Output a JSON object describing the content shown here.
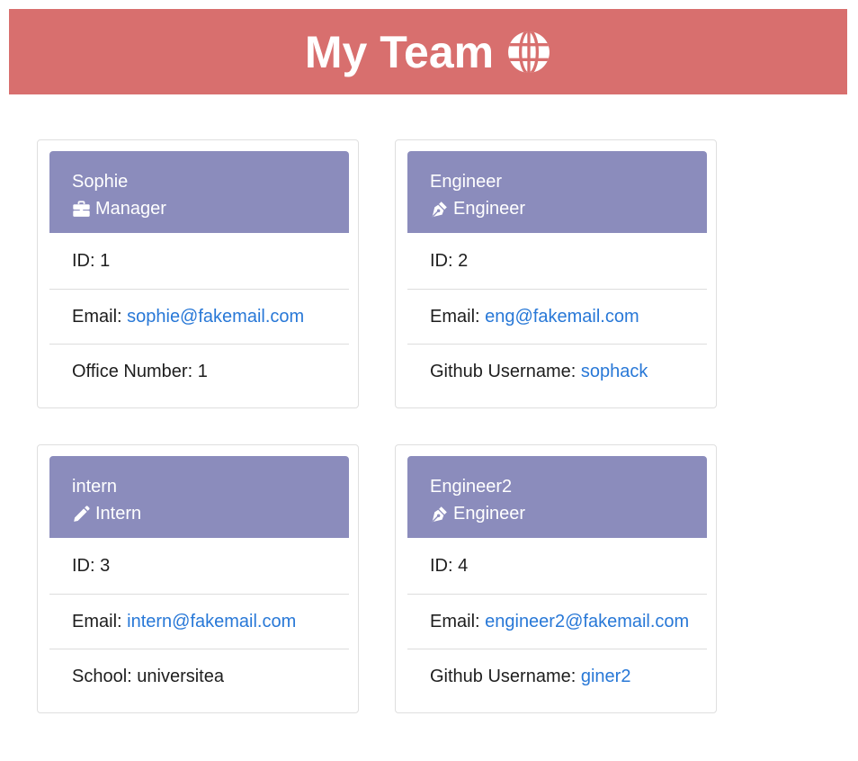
{
  "colors": {
    "header_bg": "#d86f6e",
    "card_header_bg": "#8b8cbc",
    "link": "#2878d7"
  },
  "header": {
    "title": "My Team",
    "icon": "globe-icon"
  },
  "cards": [
    {
      "name": "Sophie",
      "role": "Manager",
      "role_icon": "briefcase-icon",
      "id_label": "ID: ",
      "id": "1",
      "email_label": "Email: ",
      "email": "sophie@fakemail.com",
      "extra_label": "Office Number: ",
      "extra_value": "1",
      "extra_is_link": false
    },
    {
      "name": "Engineer",
      "role": "Engineer",
      "role_icon": "pen-nib-icon",
      "id_label": "ID: ",
      "id": "2",
      "email_label": "Email: ",
      "email": "eng@fakemail.com",
      "extra_label": "Github Username: ",
      "extra_value": "sophack",
      "extra_is_link": true
    },
    {
      "name": "intern",
      "role": "Intern",
      "role_icon": "pencil-icon",
      "id_label": "ID: ",
      "id": "3",
      "email_label": "Email: ",
      "email": "intern@fakemail.com",
      "extra_label": "School: ",
      "extra_value": "universitea",
      "extra_is_link": false
    },
    {
      "name": "Engineer2",
      "role": "Engineer",
      "role_icon": "pen-nib-icon",
      "id_label": "ID: ",
      "id": "4",
      "email_label": "Email: ",
      "email": "engineer2@fakemail.com",
      "extra_label": "Github Username: ",
      "extra_value": "giner2",
      "extra_is_link": true
    }
  ]
}
